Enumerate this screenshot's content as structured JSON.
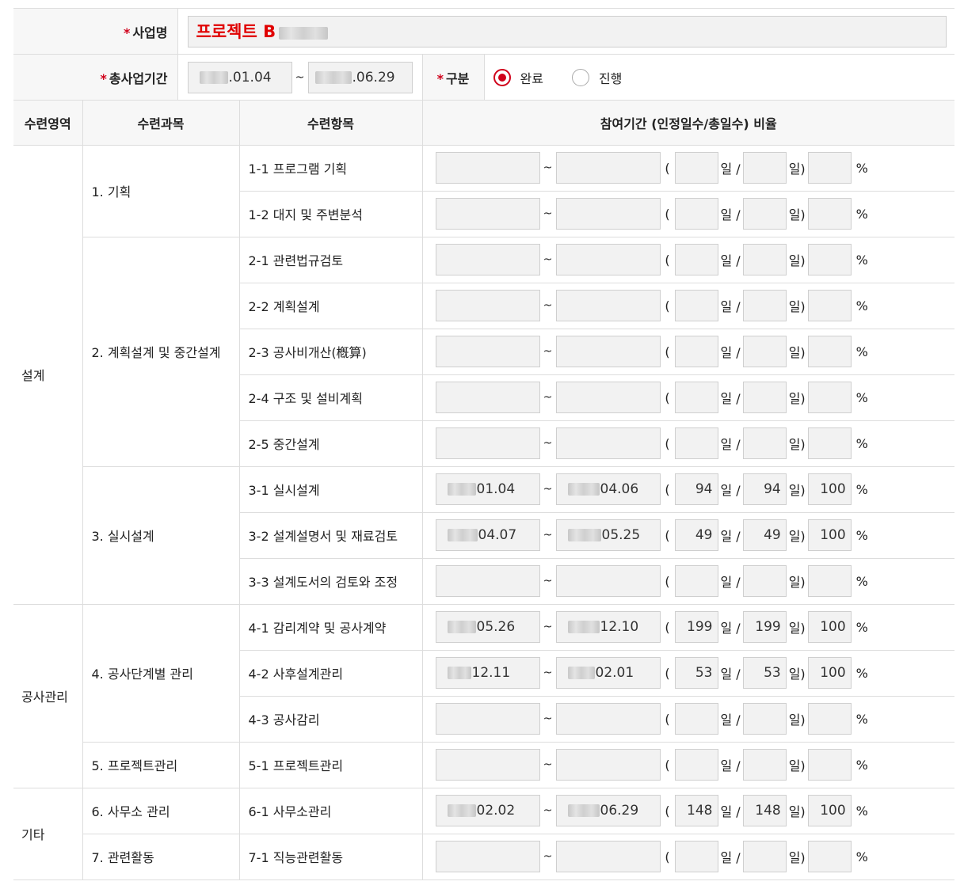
{
  "form": {
    "project_label": "사업명",
    "project_name": "프로젝트 B",
    "period_label": "총사업기간",
    "period_start": ".01.04",
    "period_end": ".06.29",
    "tilde": "~",
    "status_label": "구분",
    "status_options": [
      {
        "label": "완료",
        "selected": true
      },
      {
        "label": "진행",
        "selected": false
      }
    ]
  },
  "table": {
    "headers": [
      "수련영역",
      "수련과목",
      "수련항목",
      "참여기간 (인정일수/총일수) 비율"
    ],
    "units": {
      "paren_open": "(",
      "day_slash": "일 /",
      "day_close": "일)",
      "percent": "%"
    },
    "areas": [
      {
        "label": "설계"
      },
      {
        "label": "공사관리"
      },
      {
        "label": "기타"
      }
    ],
    "courses": [
      {
        "label": "1. 기획"
      },
      {
        "label": "2. 계획설계 및 중간설계"
      },
      {
        "label": "3. 실시설계"
      },
      {
        "label": "4. 공사단계별 관리"
      },
      {
        "label": "5. 프로젝트관리"
      },
      {
        "label": "6. 사무소 관리"
      },
      {
        "label": "7. 관련활동"
      }
    ],
    "rows": [
      {
        "item": "1-1 프로그램 기획",
        "start": "",
        "end": "",
        "approved": "",
        "total": "",
        "ratio": ""
      },
      {
        "item": "1-2 대지 및 주변분석",
        "start": "",
        "end": "",
        "approved": "",
        "total": "",
        "ratio": ""
      },
      {
        "item": "2-1 관련법규검토",
        "start": "",
        "end": "",
        "approved": "",
        "total": "",
        "ratio": ""
      },
      {
        "item": "2-2 계획설계",
        "start": "",
        "end": "",
        "approved": "",
        "total": "",
        "ratio": ""
      },
      {
        "item": "2-3 공사비개산(槪算)",
        "start": "",
        "end": "",
        "approved": "",
        "total": "",
        "ratio": ""
      },
      {
        "item": "2-4 구조 및 설비계획",
        "start": "",
        "end": "",
        "approved": "",
        "total": "",
        "ratio": ""
      },
      {
        "item": "2-5 중간설계",
        "start": "",
        "end": "",
        "approved": "",
        "total": "",
        "ratio": ""
      },
      {
        "item": "3-1 실시설계",
        "start": "01.04",
        "end": "04.06",
        "approved": "94",
        "total": "94",
        "ratio": "100"
      },
      {
        "item": "3-2 설계설명서 및 재료검토",
        "start": "04.07",
        "end": "05.25",
        "approved": "49",
        "total": "49",
        "ratio": "100"
      },
      {
        "item": "3-3 설계도서의 검토와 조정",
        "start": "",
        "end": "",
        "approved": "",
        "total": "",
        "ratio": ""
      },
      {
        "item": "4-1 감리계약 및 공사계약",
        "start": "05.26",
        "end": "12.10",
        "approved": "199",
        "total": "199",
        "ratio": "100"
      },
      {
        "item": "4-2 사후설계관리",
        "start": "12.11",
        "end": "02.01",
        "approved": "53",
        "total": "53",
        "ratio": "100"
      },
      {
        "item": "4-3 공사감리",
        "start": "",
        "end": "",
        "approved": "",
        "total": "",
        "ratio": ""
      },
      {
        "item": "5-1 프로젝트관리",
        "start": "",
        "end": "",
        "approved": "",
        "total": "",
        "ratio": ""
      },
      {
        "item": "6-1 사무소관리",
        "start": "02.02",
        "end": "06.29",
        "approved": "148",
        "total": "148",
        "ratio": "100"
      },
      {
        "item": "7-1 직능관련활동",
        "start": "",
        "end": "",
        "approved": "",
        "total": "",
        "ratio": ""
      }
    ]
  }
}
